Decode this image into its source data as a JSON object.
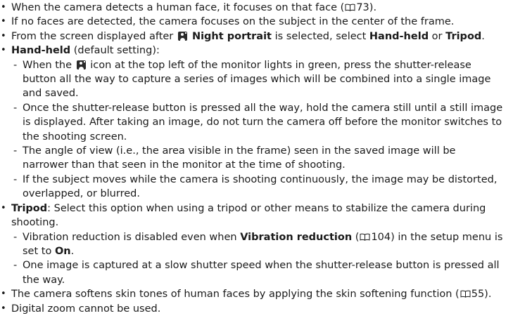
{
  "items": [
    {
      "level": 1,
      "parts": [
        {
          "t": "When the camera detects a human face, it focuses on that face ("
        },
        {
          "ref": "73"
        },
        {
          "t": ")."
        }
      ]
    },
    {
      "level": 1,
      "parts": [
        {
          "t": "If no faces are detected, the camera focuses on the subject in the center of the frame."
        }
      ]
    },
    {
      "level": 1,
      "parts": [
        {
          "t": "From the screen displayed after "
        },
        {
          "icon": "night-portrait"
        },
        {
          "b": " Night portrait"
        },
        {
          "t": " is selected, select "
        },
        {
          "b": "Hand-held"
        },
        {
          "t": " or "
        },
        {
          "b": "Tripod"
        },
        {
          "t": "."
        }
      ]
    },
    {
      "level": 1,
      "parts": [
        {
          "b": "Hand-held"
        },
        {
          "t": " (default setting):"
        }
      ]
    },
    {
      "level": 2,
      "parts": [
        {
          "t": "When the "
        },
        {
          "icon": "night-portrait"
        },
        {
          "t": " icon at the top left of the monitor lights in green, press the shutter-release button all the way to capture a series of images which will be combined into a single image and saved."
        }
      ]
    },
    {
      "level": 2,
      "parts": [
        {
          "t": "Once the shutter-release button is pressed all the way, hold the camera still until a still image is displayed. After taking an image, do not turn the camera off before the monitor switches to the shooting screen."
        }
      ]
    },
    {
      "level": 2,
      "parts": [
        {
          "t": "The angle of view (i.e., the area visible in the frame) seen in the saved image will be narrower than that seen in the monitor at the time of shooting."
        }
      ]
    },
    {
      "level": 2,
      "parts": [
        {
          "t": "If the subject moves while the camera is shooting continuously, the image may be distorted, overlapped, or blurred."
        }
      ]
    },
    {
      "level": 1,
      "parts": [
        {
          "b": "Tripod"
        },
        {
          "t": ": Select this option when using a tripod or other means to stabilize the camera during shooting."
        }
      ]
    },
    {
      "level": 2,
      "parts": [
        {
          "t": "Vibration reduction is disabled even when "
        },
        {
          "b": "Vibration reduction"
        },
        {
          "t": " ("
        },
        {
          "ref": "104"
        },
        {
          "t": ") in the setup menu is set to "
        },
        {
          "b": "On"
        },
        {
          "t": "."
        }
      ]
    },
    {
      "level": 2,
      "parts": [
        {
          "t": "One image is captured at a slow shutter speed when the shutter-release button is pressed all the way."
        }
      ]
    },
    {
      "level": 1,
      "parts": [
        {
          "t": "The camera softens skin tones of human faces by applying the skin softening function ("
        },
        {
          "ref": "55"
        },
        {
          "t": ")."
        }
      ]
    },
    {
      "level": 1,
      "parts": [
        {
          "t": "Digital zoom cannot be used."
        }
      ]
    }
  ]
}
